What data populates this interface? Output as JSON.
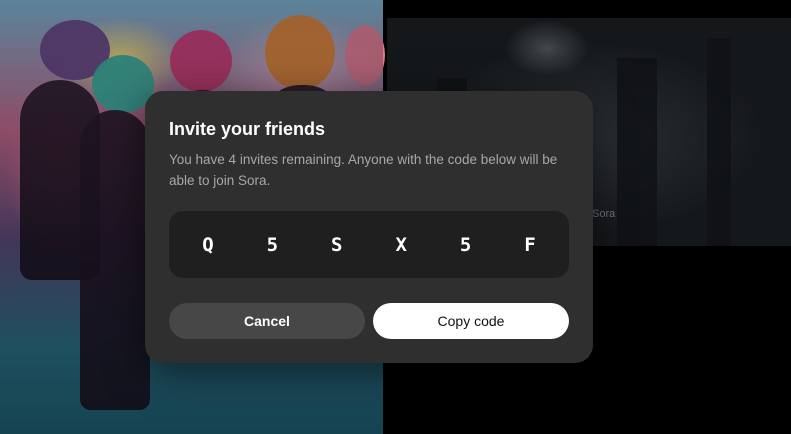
{
  "modal": {
    "title": "Invite your friends",
    "description": "You have 4 invites remaining. Anyone with the code below will be able to join Sora.",
    "invite_code": [
      "Q",
      "5",
      "S",
      "X",
      "5",
      "F"
    ],
    "cancel_label": "Cancel",
    "copy_label": "Copy code"
  },
  "background": {
    "right_caption": "Sora"
  },
  "colors": {
    "modal_bg": "#2f2f2f",
    "code_box_bg": "#1f1f1f",
    "cancel_bg": "#474747",
    "copy_bg": "#ffffff"
  }
}
